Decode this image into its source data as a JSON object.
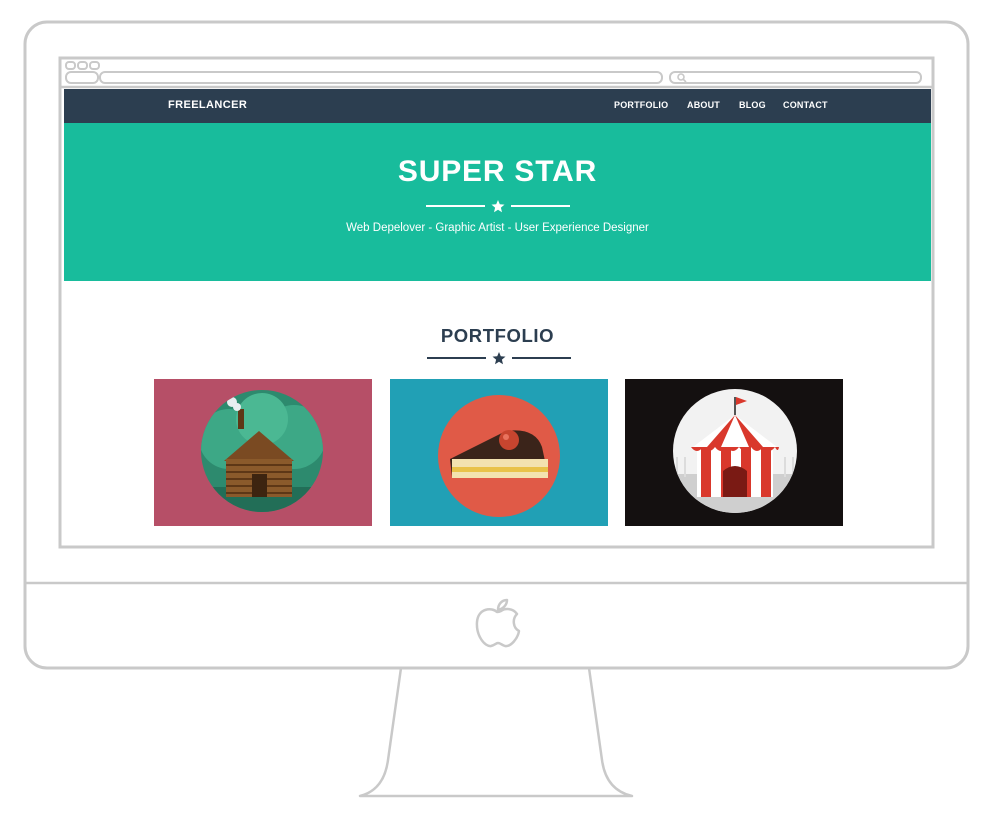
{
  "navbar": {
    "brand": "FREELANCER",
    "links": [
      "PORTFOLIO",
      "ABOUT",
      "BLOG",
      "CONTACT"
    ]
  },
  "hero": {
    "title": "SUPER STAR",
    "subtitle": "Web Depelover - Graphic Artist - User Experience Designer"
  },
  "portfolio": {
    "title": "PORTFOLIO",
    "items": [
      {
        "icon": "log-cabin-icon",
        "background": "#b64f67"
      },
      {
        "icon": "cake-slice-icon",
        "background": "#21a0b5"
      },
      {
        "icon": "circus-tent-icon",
        "background": "#141010"
      }
    ]
  },
  "colors": {
    "navbar": "#2c3e50",
    "hero": "#18bc9c",
    "heading": "#2c3e50"
  }
}
